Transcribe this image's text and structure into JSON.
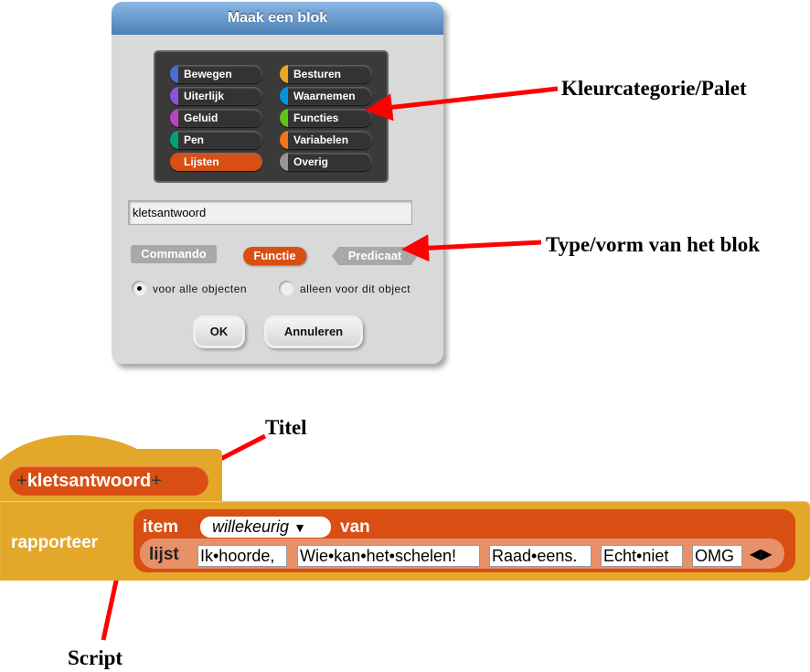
{
  "dialog": {
    "title": "Maak een blok",
    "categories": [
      {
        "label": "Bewegen",
        "color": "#4a6cd4"
      },
      {
        "label": "Besturen",
        "color": "#e6a822"
      },
      {
        "label": "Uiterlijk",
        "color": "#8a55d7"
      },
      {
        "label": "Waarnemen",
        "color": "#0494dc"
      },
      {
        "label": "Geluid",
        "color": "#bb42c3"
      },
      {
        "label": "Functies",
        "color": "#62c213"
      },
      {
        "label": "Pen",
        "color": "#00a178"
      },
      {
        "label": "Variabelen",
        "color": "#f3761d"
      },
      {
        "label": "Lijsten",
        "color": "#d94e12",
        "selected": true
      },
      {
        "label": "Overig",
        "color": "#969696"
      }
    ],
    "block_name": "kletsantwoord",
    "types": {
      "command": "Commando",
      "reporter": "Functie",
      "predicate": "Predicaat",
      "selected": "Functie"
    },
    "scope": {
      "all": "voor alle objecten",
      "this": "alleen voor dit object",
      "selected": "all"
    },
    "ok": "OK",
    "cancel": "Annuleren"
  },
  "annotations": {
    "palette": "Kleurcategorie/Palet",
    "type": "Type/vorm van het blok",
    "title": "Titel",
    "script": "Script"
  },
  "block": {
    "title_plus": "+",
    "title": "kletsantwoord",
    "report": "rapporteer",
    "item": "item",
    "index": "willekeurig",
    "of": "van",
    "list": "lijst",
    "items": [
      "Ik•hoorde,",
      "Wie•kan•het•schelen!",
      "Raad•eens.",
      "Echt•niet",
      "OMG"
    ]
  }
}
